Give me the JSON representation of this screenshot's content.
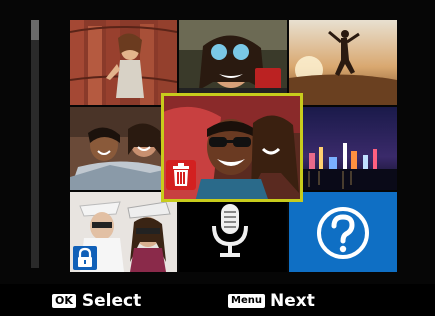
{
  "thumbnails": [
    {
      "name": "photo-girl-fence",
      "kind": "photo"
    },
    {
      "name": "photo-girl-camera",
      "kind": "photo"
    },
    {
      "name": "photo-sunset-jump",
      "kind": "photo"
    },
    {
      "name": "photo-friends-couch",
      "kind": "photo"
    },
    {
      "name": "photo-friends-sunglasses",
      "kind": "photo",
      "selected": true,
      "badge": "trash-icon"
    },
    {
      "name": "photo-city-night",
      "kind": "photo"
    },
    {
      "name": "photo-friends-hats",
      "kind": "photo",
      "badge": "lock-icon"
    },
    {
      "name": "voice-memo",
      "kind": "audio",
      "icon": "microphone-icon"
    },
    {
      "name": "unknown-file",
      "kind": "unknown",
      "icon": "question-icon"
    }
  ],
  "selection_color": "#c8cc1c",
  "footer": {
    "ok_key": "OK",
    "ok_label": "Select",
    "menu_key": "Menu",
    "menu_label": "Next"
  }
}
